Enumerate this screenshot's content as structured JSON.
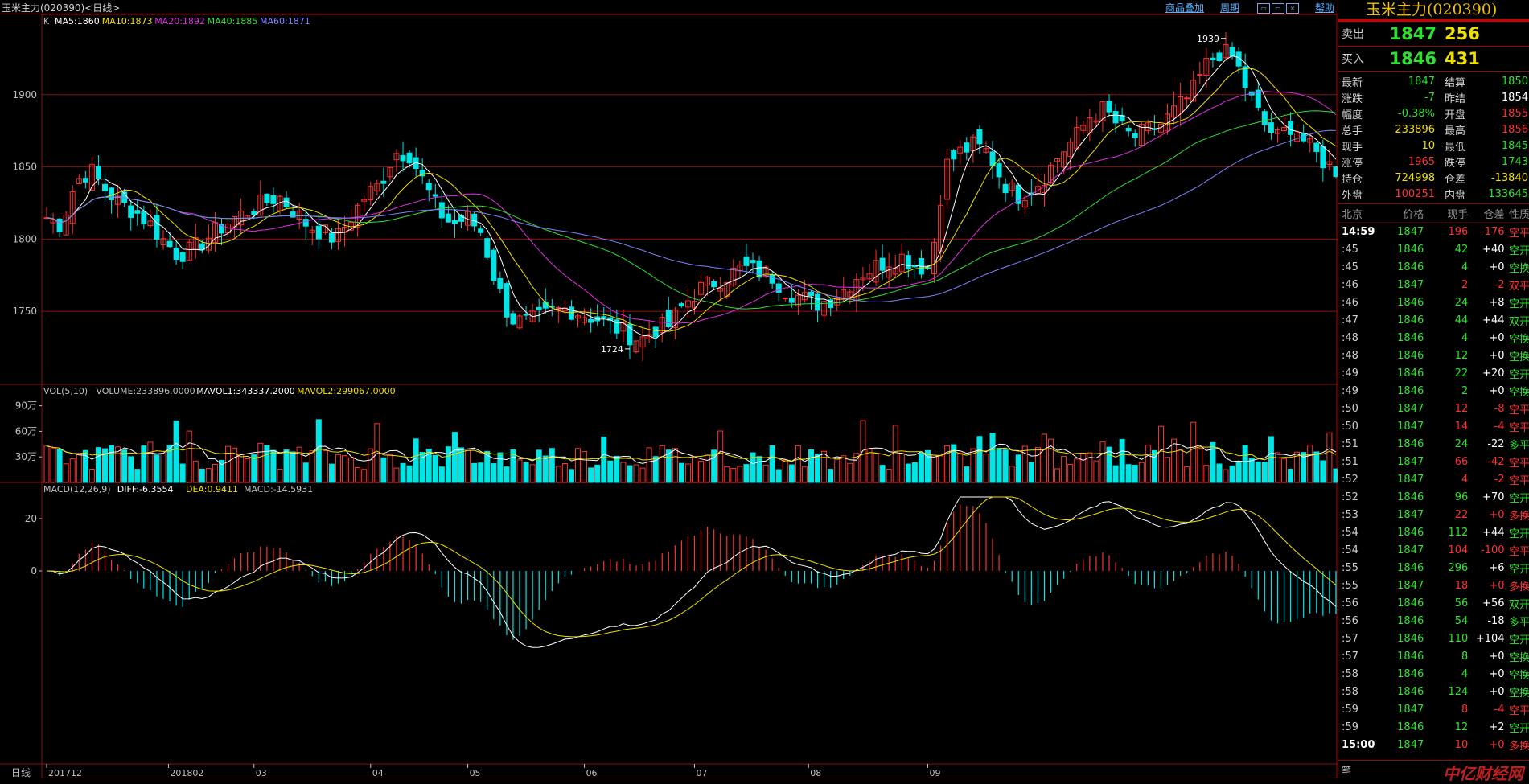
{
  "window": {
    "title": "玉米主力(020390)<日线>",
    "links": [
      "商品叠加",
      "周期",
      "帮助"
    ]
  },
  "main_panel": {
    "label": "K",
    "ma": [
      {
        "text": "MA5:1860",
        "color": "#ffffff"
      },
      {
        "text": "MA10:1873",
        "color": "#f0e000"
      },
      {
        "text": "MA20:1892",
        "color": "#e030e0"
      },
      {
        "text": "MA40:1885",
        "color": "#30e030"
      },
      {
        "text": "MA60:1871",
        "color": "#8080ff"
      }
    ],
    "yticks": [
      "1900",
      "1850",
      "1800",
      "1750"
    ],
    "high_label": "1939",
    "low_label": "1724"
  },
  "vol_panel": {
    "legend": [
      {
        "text": "VOL(5,10)",
        "color": "#c0c0c0"
      },
      {
        "text": "VOLUME:233896.0000",
        "color": "#c0c0c0"
      },
      {
        "text": "MAVOL1:343337.2000",
        "color": "#ffffff"
      },
      {
        "text": "MAVOL2:299067.0000",
        "color": "#f0e000"
      }
    ],
    "yticks": [
      "90万",
      "60万",
      "30万"
    ]
  },
  "macd_panel": {
    "legend": [
      {
        "text": "MACD(12,26,9)",
        "color": "#c0c0c0"
      },
      {
        "text": "DIFF:-6.3554",
        "color": "#ffffff"
      },
      {
        "text": "DEA:0.9411",
        "color": "#f0e000"
      },
      {
        "text": "MACD:-14.5931",
        "color": "#c0c0c0"
      }
    ],
    "yticks": [
      "20",
      "0"
    ]
  },
  "x_axis": {
    "period": "日线",
    "labels": [
      "201712",
      "201802",
      "03",
      "04",
      "05",
      "06",
      "07",
      "08",
      "09"
    ]
  },
  "colors": {
    "up": "#ff3232",
    "down": "#00e5e5",
    "ma5": "#ffffff",
    "ma10": "#f0e000",
    "ma20": "#e030e0",
    "ma40": "#30e030",
    "ma60": "#8080ff",
    "grid": "#8a1010"
  },
  "chart_data": {
    "type": "candlestick",
    "symbol": "玉米主力(020390)",
    "interval": "日线",
    "x": [
      "201712",
      "201802",
      "03",
      "04",
      "05",
      "06",
      "07",
      "08",
      "09"
    ],
    "y_ticks": [
      1750,
      1800,
      1850,
      1900
    ],
    "high": 1939,
    "low": 1724,
    "ma_last": {
      "MA5": 1860,
      "MA10": 1873,
      "MA20": 1892,
      "MA40": 1885,
      "MA60": 1871
    },
    "volume_last": 233896,
    "macd_last": {
      "DIFF": -6.3554,
      "DEA": 0.9411,
      "MACD": -14.5931
    },
    "close_path": [
      1815,
      1810,
      1840,
      1848,
      1835,
      1825,
      1820,
      1812,
      1800,
      1790,
      1792,
      1800,
      1808,
      1815,
      1820,
      1825,
      1830,
      1820,
      1810,
      1805,
      1800,
      1815,
      1830,
      1838,
      1860,
      1860,
      1840,
      1820,
      1810,
      1815,
      1805,
      1770,
      1745,
      1742,
      1745,
      1750,
      1752,
      1748,
      1745,
      1740,
      1735,
      1730,
      1738,
      1740,
      1755,
      1765,
      1770,
      1775,
      1780,
      1778,
      1775,
      1765,
      1760,
      1755,
      1758,
      1765,
      1775,
      1780,
      1785,
      1788,
      1782,
      1780,
      1850,
      1860,
      1865,
      1860,
      1840,
      1830,
      1835,
      1845,
      1860,
      1870,
      1885,
      1890,
      1878,
      1870,
      1875,
      1880,
      1890,
      1900,
      1920,
      1930,
      1925,
      1900,
      1880,
      1870,
      1880,
      1865,
      1855,
      1848
    ]
  },
  "side": {
    "title": "玉米主力(020390)",
    "sell": {
      "label": "卖出",
      "price": "1847",
      "vol": "256"
    },
    "buy": {
      "label": "买入",
      "price": "1846",
      "vol": "431"
    },
    "stats": [
      {
        "k1": "最新",
        "v1": "1847",
        "c1": "green",
        "k2": "结算",
        "v2": "1850",
        "c2": "green"
      },
      {
        "k1": "涨跌",
        "v1": "-7",
        "c1": "green",
        "k2": "昨结",
        "v2": "1854",
        "c2": "white"
      },
      {
        "k1": "幅度",
        "v1": "-0.38%",
        "c1": "green",
        "k2": "开盘",
        "v2": "1855",
        "c2": "red"
      },
      {
        "k1": "总手",
        "v1": "233896",
        "c1": "yellow",
        "k2": "最高",
        "v2": "1856",
        "c2": "red"
      },
      {
        "k1": "现手",
        "v1": "10",
        "c1": "yellow",
        "k2": "最低",
        "v2": "1845",
        "c2": "green"
      },
      {
        "k1": "涨停",
        "v1": "1965",
        "c1": "red",
        "k2": "跌停",
        "v2": "1743",
        "c2": "green"
      },
      {
        "k1": "持仓",
        "v1": "724998",
        "c1": "yellow",
        "k2": "仓差",
        "v2": "-13840",
        "c2": "yellow"
      },
      {
        "k1": "外盘",
        "v1": "100251",
        "c1": "red",
        "k2": "内盘",
        "v2": "133645",
        "c2": "green"
      }
    ],
    "tick_header": [
      "北京",
      "价格",
      "现手",
      "仓差",
      "性质"
    ],
    "ticks": [
      {
        "t": "14:59",
        "p": "1847",
        "pc": "green",
        "v": "196",
        "vc": "red",
        "o": "-176",
        "n": "空平",
        "nc": "red"
      },
      {
        "t": ":45",
        "p": "1846",
        "pc": "green",
        "v": "42",
        "vc": "green",
        "o": "+40",
        "n": "空开",
        "nc": "green"
      },
      {
        "t": ":45",
        "p": "1846",
        "pc": "green",
        "v": "4",
        "vc": "green",
        "o": "+0",
        "n": "空换",
        "nc": "green"
      },
      {
        "t": ":46",
        "p": "1847",
        "pc": "green",
        "v": "2",
        "vc": "red",
        "o": "-2",
        "n": "双平",
        "nc": "red"
      },
      {
        "t": ":46",
        "p": "1846",
        "pc": "green",
        "v": "24",
        "vc": "green",
        "o": "+8",
        "n": "空开",
        "nc": "green"
      },
      {
        "t": ":47",
        "p": "1846",
        "pc": "green",
        "v": "44",
        "vc": "green",
        "o": "+44",
        "n": "双开",
        "nc": "green"
      },
      {
        "t": ":48",
        "p": "1846",
        "pc": "green",
        "v": "4",
        "vc": "green",
        "o": "+0",
        "n": "空换",
        "nc": "green"
      },
      {
        "t": ":48",
        "p": "1846",
        "pc": "green",
        "v": "12",
        "vc": "green",
        "o": "+0",
        "n": "空换",
        "nc": "green"
      },
      {
        "t": ":49",
        "p": "1846",
        "pc": "green",
        "v": "22",
        "vc": "green",
        "o": "+20",
        "n": "空开",
        "nc": "green"
      },
      {
        "t": ":49",
        "p": "1846",
        "pc": "green",
        "v": "2",
        "vc": "green",
        "o": "+0",
        "n": "空换",
        "nc": "green"
      },
      {
        "t": ":50",
        "p": "1847",
        "pc": "green",
        "v": "12",
        "vc": "red",
        "o": "-8",
        "n": "空平",
        "nc": "red"
      },
      {
        "t": ":50",
        "p": "1847",
        "pc": "green",
        "v": "14",
        "vc": "red",
        "o": "-4",
        "n": "空平",
        "nc": "red"
      },
      {
        "t": ":51",
        "p": "1846",
        "pc": "green",
        "v": "24",
        "vc": "green",
        "o": "-22",
        "n": "多平",
        "nc": "green"
      },
      {
        "t": ":51",
        "p": "1847",
        "pc": "green",
        "v": "66",
        "vc": "red",
        "o": "-42",
        "n": "空平",
        "nc": "red"
      },
      {
        "t": ":52",
        "p": "1847",
        "pc": "green",
        "v": "4",
        "vc": "red",
        "o": "-2",
        "n": "空平",
        "nc": "red"
      },
      {
        "t": ":52",
        "p": "1846",
        "pc": "green",
        "v": "96",
        "vc": "green",
        "o": "+70",
        "n": "空开",
        "nc": "green"
      },
      {
        "t": ":53",
        "p": "1847",
        "pc": "green",
        "v": "22",
        "vc": "red",
        "o": "+0",
        "n": "多换",
        "nc": "red"
      },
      {
        "t": ":54",
        "p": "1846",
        "pc": "green",
        "v": "112",
        "vc": "green",
        "o": "+44",
        "n": "空开",
        "nc": "green"
      },
      {
        "t": ":54",
        "p": "1847",
        "pc": "green",
        "v": "104",
        "vc": "red",
        "o": "-100",
        "n": "空平",
        "nc": "red"
      },
      {
        "t": ":55",
        "p": "1846",
        "pc": "green",
        "v": "296",
        "vc": "green",
        "o": "+6",
        "n": "空开",
        "nc": "green"
      },
      {
        "t": ":55",
        "p": "1847",
        "pc": "green",
        "v": "18",
        "vc": "red",
        "o": "+0",
        "n": "多换",
        "nc": "red"
      },
      {
        "t": ":56",
        "p": "1846",
        "pc": "green",
        "v": "56",
        "vc": "green",
        "o": "+56",
        "n": "双开",
        "nc": "green"
      },
      {
        "t": ":56",
        "p": "1846",
        "pc": "green",
        "v": "54",
        "vc": "green",
        "o": "-18",
        "n": "多平",
        "nc": "green"
      },
      {
        "t": ":57",
        "p": "1846",
        "pc": "green",
        "v": "110",
        "vc": "green",
        "o": "+104",
        "n": "空开",
        "nc": "green"
      },
      {
        "t": ":57",
        "p": "1846",
        "pc": "green",
        "v": "8",
        "vc": "green",
        "o": "+0",
        "n": "空换",
        "nc": "green"
      },
      {
        "t": ":58",
        "p": "1846",
        "pc": "green",
        "v": "4",
        "vc": "green",
        "o": "+0",
        "n": "空换",
        "nc": "green"
      },
      {
        "t": ":58",
        "p": "1846",
        "pc": "green",
        "v": "124",
        "vc": "green",
        "o": "+0",
        "n": "空换",
        "nc": "green"
      },
      {
        "t": ":59",
        "p": "1847",
        "pc": "green",
        "v": "8",
        "vc": "red",
        "o": "-4",
        "n": "空平",
        "nc": "red"
      },
      {
        "t": ":59",
        "p": "1846",
        "pc": "green",
        "v": "12",
        "vc": "green",
        "o": "+2",
        "n": "空开",
        "nc": "green"
      },
      {
        "t": "15:00",
        "p": "1847",
        "pc": "green",
        "v": "10",
        "vc": "red",
        "o": "+0",
        "n": "多换",
        "nc": "red"
      }
    ],
    "footer_label": "笔",
    "watermark": "中亿财经网"
  }
}
